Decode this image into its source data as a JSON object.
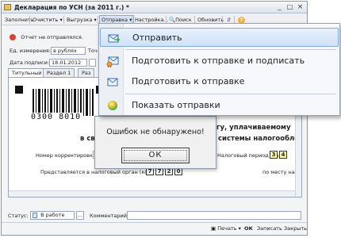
{
  "window": {
    "title": "Декларация по УСН (за 2011 г.) *",
    "controls": [
      "_",
      "□",
      "×"
    ]
  },
  "toolbar": {
    "fill": "Заполнить",
    "clear": "Очистить",
    "upload": "Выгрузка",
    "send": "Отправка",
    "settings": "Настройка...",
    "search": "Поиск",
    "refresh": "Обновить",
    "help": "?"
  },
  "header": {
    "not_sent_status": "Отчет не отправлялся."
  },
  "form": {
    "unit_label": "Ед. измерения:",
    "unit_value": "в рублях",
    "accuracy_label": "Точ",
    "sign_date_label": "Дата подписи:",
    "sign_date_value": "18.01.2012"
  },
  "tabs": [
    "Титульный",
    "Раздел 1",
    "Раз"
  ],
  "document": {
    "barcode_number": "0300 8010",
    "title_fragment_1": "гу, уплачиваемому",
    "title_fragment_2": "в свя",
    "title_fragment_3": "системы налогообло",
    "correction_label": "Номер корректировки",
    "period_label": "Налоговый период (код)",
    "period_code": [
      "3",
      "4"
    ],
    "authority_label": "Представляется в налоговый орган (код)",
    "authority_code": [
      "7",
      "7",
      "2",
      "0"
    ],
    "location_label": "по месту на"
  },
  "menu": {
    "items": [
      {
        "label": "Отправить",
        "icon": "send-icon",
        "selected": true
      },
      {
        "label": "Подготовить к отправке и подписать",
        "icon": "sign-envelope-icon",
        "selected": false
      },
      {
        "label": "Подготовить к отправке",
        "icon": "envelope-icon",
        "selected": false
      },
      {
        "label": "Показать отправки",
        "icon": "status-ball-icon",
        "selected": false
      }
    ]
  },
  "dialog": {
    "message": "Ошибок не обнаружено!",
    "ok": "ОК"
  },
  "status": {
    "label": "Статус:",
    "value": "В работе",
    "comment_label": "Комментарий:"
  },
  "footer": {
    "print": "Печать",
    "ok": "ОК",
    "save": "Записать",
    "close": "Закрыть"
  }
}
